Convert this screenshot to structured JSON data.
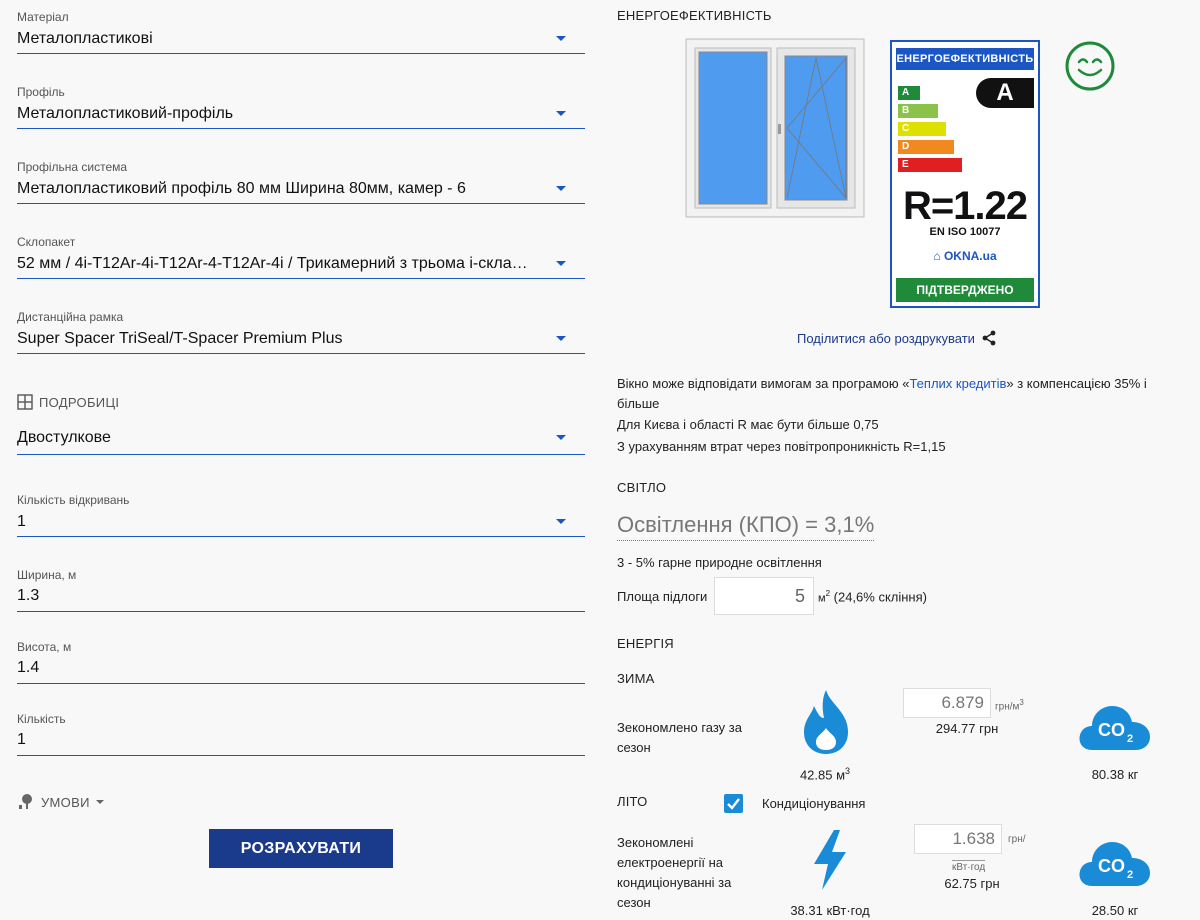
{
  "form": {
    "material": {
      "label": "Матеріал",
      "value": "Металопластикові"
    },
    "profile": {
      "label": "Профіль",
      "value": "Металопластиковий-профіль"
    },
    "profile_system": {
      "label": "Профільна система",
      "value": "Металопластиковий профіль 80 мм Ширина 80мм, камер - 6"
    },
    "glass_unit": {
      "label": "Склопакет",
      "value": "52 мм / 4і-Т12Ar-4і-Т12Ar-4-Т12Ar-4і / Трикамерний з трьома і-скла…"
    },
    "spacer": {
      "label": "Дистанційна рамка",
      "value": "Super Spacer TriSeal/T-Spacer Premium Plus"
    },
    "details_header": "ПОДРОБИЦІ",
    "window_type": {
      "value": "Двостулкове"
    },
    "openings": {
      "label": "Кількість відкривань",
      "value": "1"
    },
    "width": {
      "label": "Ширина, м",
      "value": "1.3"
    },
    "height": {
      "label": "Висота, м",
      "value": "1.4"
    },
    "quantity": {
      "label": "Кількість",
      "value": "1"
    },
    "conditions_header": "УМОВИ",
    "calculate_button": "РОЗРАХУВАТИ"
  },
  "energy_label": {
    "section_title": "ЕНЕРГОЕФЕКТИВНІСТЬ",
    "card_title": "ЕНЕРГОЕФЕКТИВНІСТЬ",
    "grade": "A",
    "classes": [
      "A",
      "B",
      "C",
      "D",
      "E"
    ],
    "r_value": "R=1.22",
    "standard": "EN ISO 10077",
    "brand": "OKNA.ua",
    "confirmed": "ПІДТВЕРДЖЕНО",
    "share_link": "Поділитися або роздрукувати"
  },
  "program": {
    "text_before": "Вікно може відповідати вимогам за програмою «",
    "link": "Теплих кредитів",
    "text_after": "» з компенсацією 35% і більше",
    "kyiv_note": "Для Києва і області R має бути більше 0,75",
    "loss_note": "З урахуванням втрат через повітропроникність R=1,15"
  },
  "light": {
    "title": "СВІТЛО",
    "value": "Освітлення (КПО) = 3,1%",
    "note": "3 - 5% гарне природне освітлення",
    "floor_label": "Площа підлоги",
    "floor_value": "5",
    "floor_unit": "м",
    "floor_sup": "2",
    "glazing": "(24,6% скління)"
  },
  "energy": {
    "title": "ЕНЕРГІЯ",
    "winter": {
      "title": "ЗИМА",
      "label": "Зекономлено газу за сезон",
      "gas_amount": "42.85 м",
      "gas_sup": "3",
      "price": "6.879",
      "price_unit": "грн/м",
      "price_sup": "3",
      "money": "294.77 грн",
      "co2_amount": "80.38 кг"
    },
    "summer": {
      "title": "ЛІТО",
      "ac_label": "Кондиціонування",
      "label": "Зекономлені електроенергії на кондиціонуванні за сезон",
      "price": "1.638",
      "price_unit_1": "грн/",
      "price_unit_2": "кВт·год",
      "money": "62.75 грн",
      "energy_amount": "38.31 кВт·год",
      "co2_amount": "28.50 кг"
    }
  },
  "colors": {
    "accent": "#1a56c4",
    "button": "#1a3a8c",
    "green": "#1e8a3a",
    "co2": "#1a8bd6"
  }
}
